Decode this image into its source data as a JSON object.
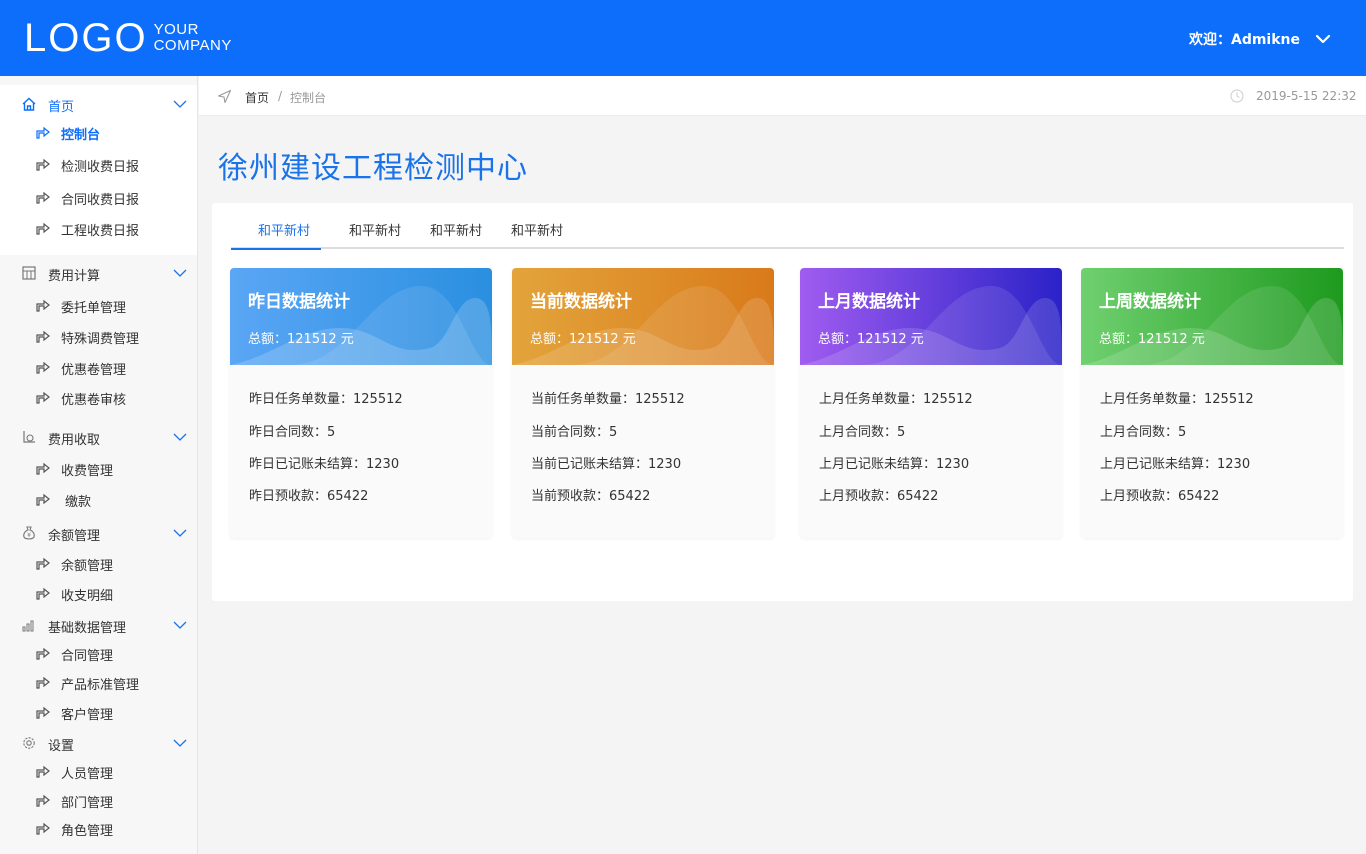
{
  "header": {
    "logo_main": "LOGO",
    "logo_sub_1": "YOUR",
    "logo_sub_2": "COMPANY",
    "welcome": "欢迎：Admikne",
    "bg_color": "#0d6efb"
  },
  "sidebar": {
    "groups": [
      {
        "label": "首页",
        "icon": "home-icon",
        "items": [
          "控制台",
          "检测收费日报",
          "合同收费日报",
          "工程收费日报"
        ]
      },
      {
        "label": "费用计算",
        "icon": "calculator-icon",
        "items": [
          "委托单管理",
          "特殊调费管理",
          "优惠卷管理",
          "优惠卷审核"
        ]
      },
      {
        "label": "费用收取",
        "icon": "payment-icon",
        "items": [
          "收费管理",
          "缴款"
        ]
      },
      {
        "label": "余额管理",
        "icon": "money-bag-icon",
        "items": [
          "余额管理",
          "收支明细"
        ]
      },
      {
        "label": "基础数据管理",
        "icon": "bar-chart-icon",
        "items": [
          "合同管理",
          "产品标准管理",
          "客户管理"
        ]
      },
      {
        "label": "设置",
        "icon": "gear-icon",
        "items": [
          "人员管理",
          "部门管理",
          "角色管理"
        ]
      }
    ]
  },
  "breadcrumb": {
    "home": "首页",
    "separator": "/",
    "current": "控制台",
    "datetime": "2019-5-15 22:32"
  },
  "main": {
    "title": "徐州建设工程检测中心",
    "tabs": [
      "和平新村",
      "和平新村",
      "和平新村",
      "和平新村"
    ],
    "cards": [
      {
        "title": "昨日数据统计",
        "total": "总额：121512 元",
        "stats": [
          "昨日任务单数量：125512",
          "昨日合同数：5",
          "昨日已记账未结算：1230",
          "昨日预收款：65422"
        ],
        "color_from": "#5aa6f5",
        "color_to": "#2a8fe0"
      },
      {
        "title": "当前数据统计",
        "total": "总额：121512 元",
        "stats": [
          "当前任务单数量：125512",
          "当前合同数：5",
          "当前已记账未结算：1230",
          "当前预收款：65422"
        ],
        "color_from": "#e3a43b",
        "color_to": "#d97a1a"
      },
      {
        "title": "上月数据统计",
        "total": "总额：121512 元",
        "stats": [
          "上月任务单数量：125512",
          "上月合同数：5",
          "上月已记账未结算：1230",
          "上月预收款：65422"
        ],
        "color_from": "#a05cf0",
        "color_to": "#2a22c8"
      },
      {
        "title": "上周数据统计",
        "total": "总额：121512 元",
        "stats": [
          "上月任务单数量：125512",
          "上月合同数：5",
          "上月已记账未结算：1230",
          "上月预收款：65422"
        ],
        "color_from": "#6fd06f",
        "color_to": "#1e9a1e"
      }
    ]
  }
}
